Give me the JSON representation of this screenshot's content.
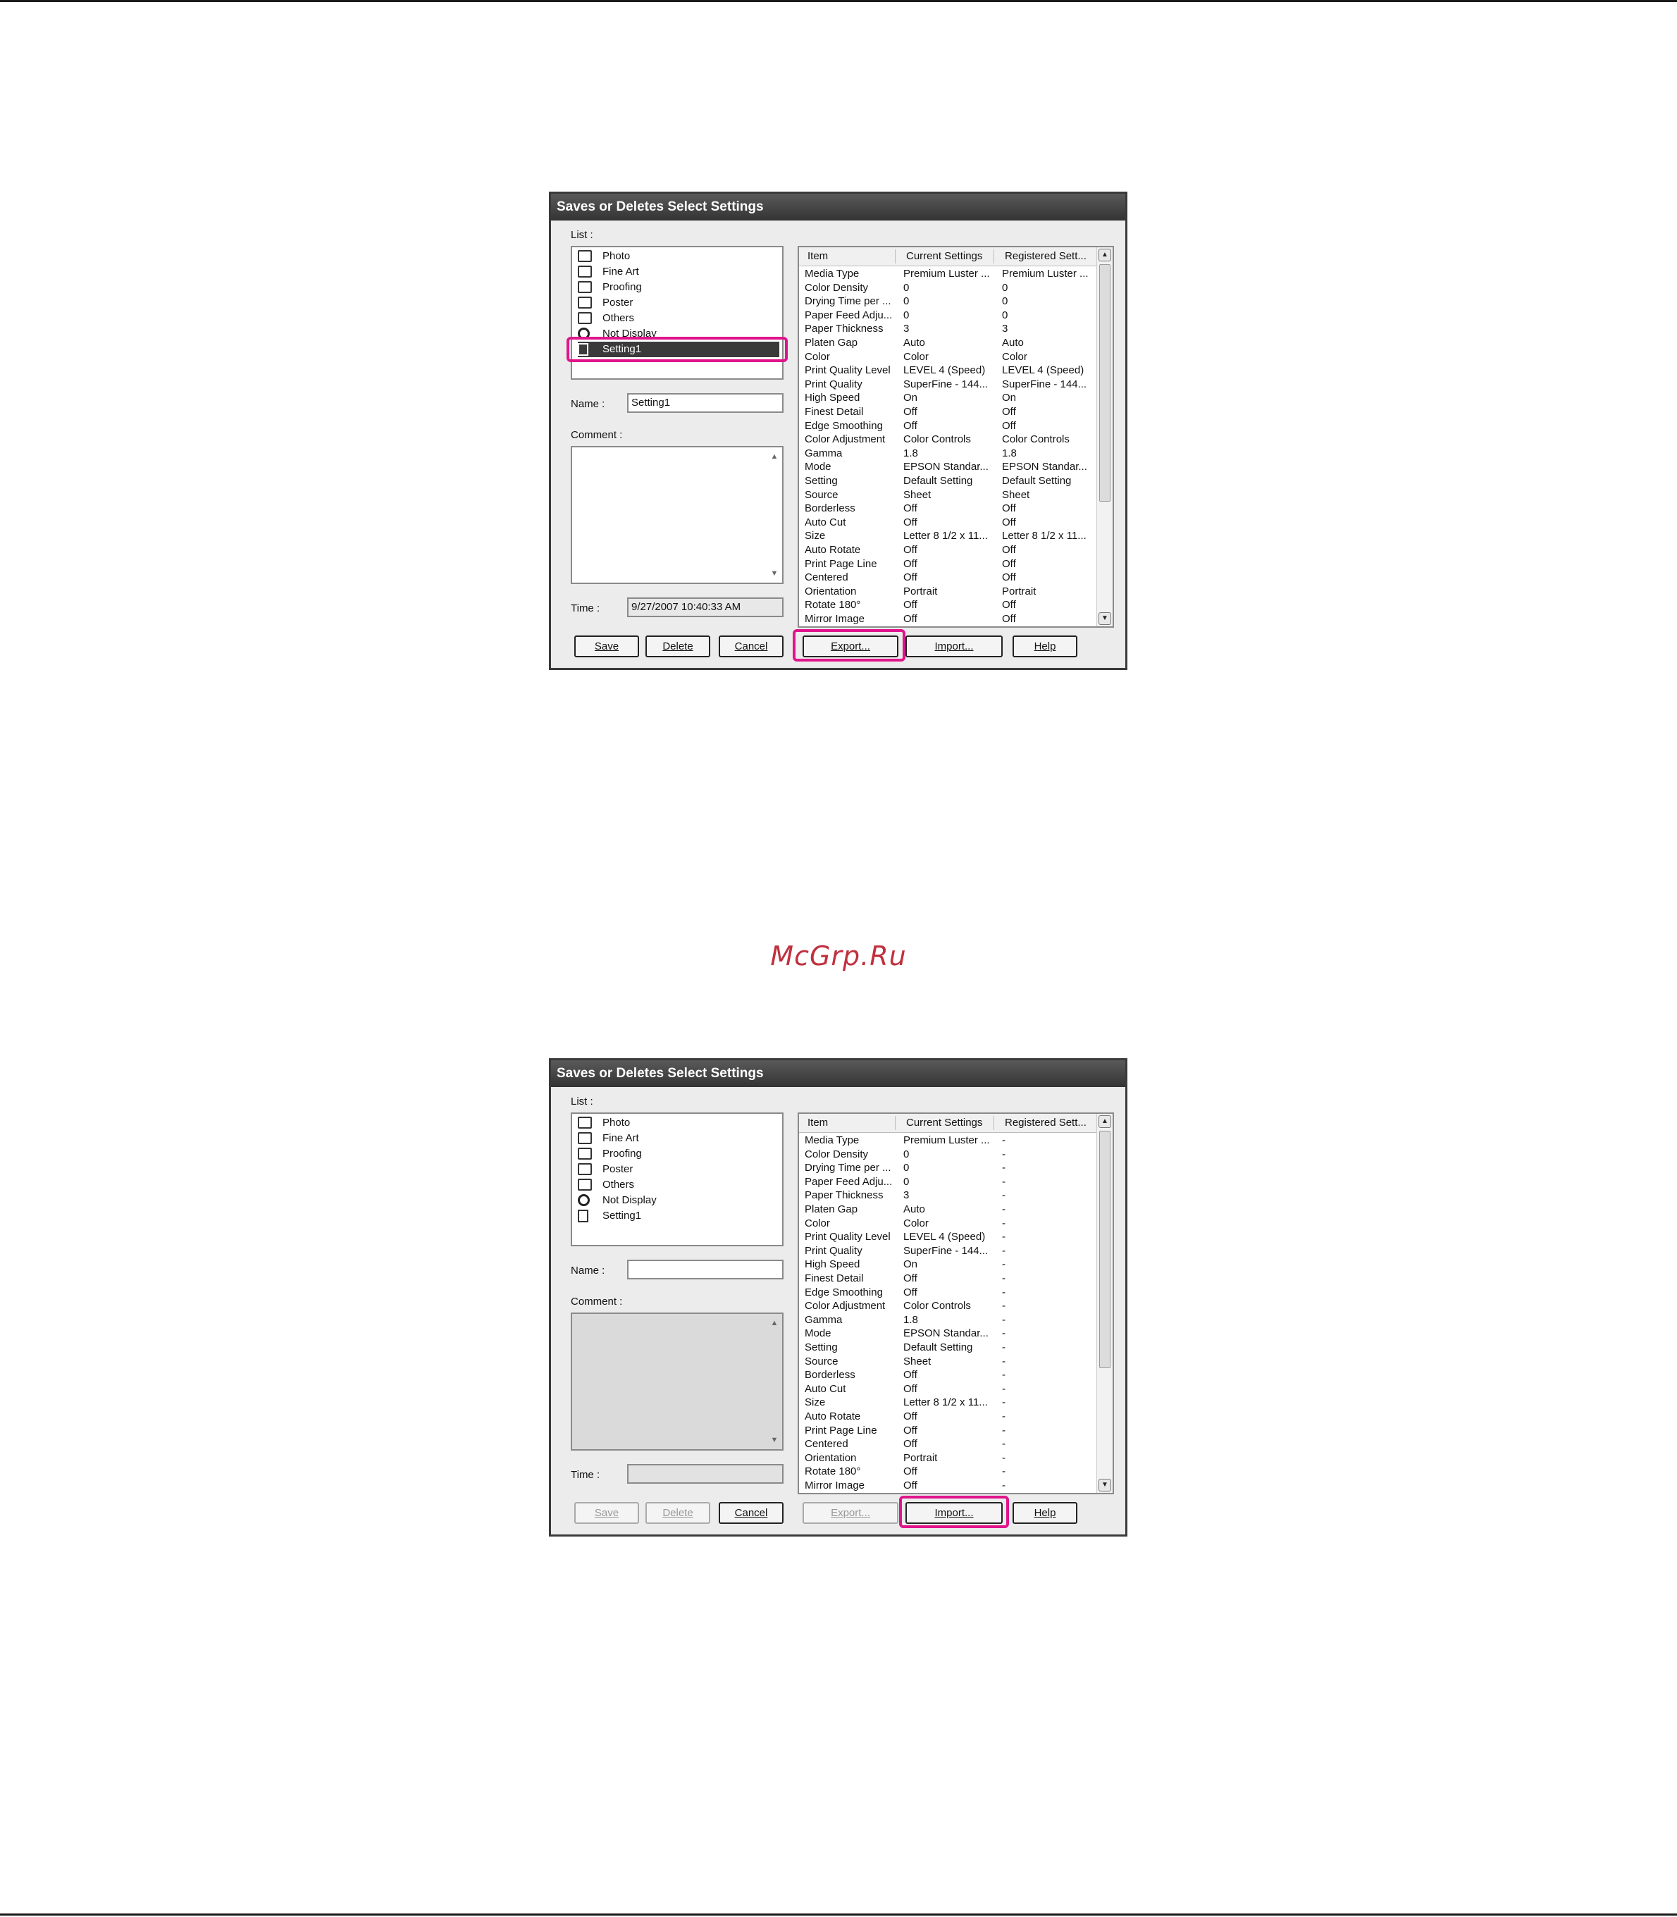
{
  "watermark": "McGrp.Ru",
  "dialogs": [
    {
      "title": "Saves or Deletes Select Settings",
      "list_label": "List :",
      "list_items": [
        {
          "label": "Photo",
          "icon": "folder-icon"
        },
        {
          "label": "Fine Art",
          "icon": "folder-icon"
        },
        {
          "label": "Proofing",
          "icon": "folder-icon"
        },
        {
          "label": "Poster",
          "icon": "folder-icon"
        },
        {
          "label": "Others",
          "icon": "folder-icon"
        },
        {
          "label": "Not Display",
          "icon": "not-display-icon"
        },
        {
          "label": "Setting1",
          "icon": "document-icon",
          "selected": true
        }
      ],
      "name_label": "Name :",
      "name_value": "Setting1",
      "comment_label": "Comment :",
      "time_label": "Time :",
      "time_value": "9/27/2007 10:40:33 AM",
      "grid_headers": [
        "Item",
        "Current Settings",
        "Registered Sett..."
      ],
      "rows": [
        [
          "Media Type",
          "Premium Luster ...",
          "Premium Luster ..."
        ],
        [
          "Color Density",
          "0",
          "0"
        ],
        [
          "Drying Time per ...",
          "0",
          "0"
        ],
        [
          "Paper Feed Adju...",
          "0",
          "0"
        ],
        [
          "Paper Thickness",
          "3",
          "3"
        ],
        [
          "Platen Gap",
          "Auto",
          "Auto"
        ],
        [
          "Color",
          "Color",
          "Color"
        ],
        [
          "Print Quality Level",
          "LEVEL 4 (Speed)",
          "LEVEL 4 (Speed)"
        ],
        [
          "Print Quality",
          "SuperFine - 144...",
          "SuperFine - 144..."
        ],
        [
          "High Speed",
          "On",
          "On"
        ],
        [
          "Finest Detail",
          "Off",
          "Off"
        ],
        [
          "Edge Smoothing",
          "Off",
          "Off"
        ],
        [
          "Color Adjustment",
          "Color Controls",
          "Color Controls"
        ],
        [
          "Gamma",
          "1.8",
          "1.8"
        ],
        [
          "Mode",
          "EPSON Standar...",
          "EPSON Standar..."
        ],
        [
          "Setting",
          "Default Setting",
          "Default Setting"
        ],
        [
          "Source",
          "Sheet",
          "Sheet"
        ],
        [
          "Borderless",
          "Off",
          "Off"
        ],
        [
          "Auto Cut",
          "Off",
          "Off"
        ],
        [
          "Size",
          "Letter 8 1/2 x 11...",
          "Letter 8 1/2 x 11..."
        ],
        [
          "Auto Rotate",
          "Off",
          "Off"
        ],
        [
          "Print Page Line",
          "Off",
          "Off"
        ],
        [
          "Centered",
          "Off",
          "Off"
        ],
        [
          "Orientation",
          "Portrait",
          "Portrait"
        ],
        [
          "Rotate 180°",
          "Off",
          "Off"
        ],
        [
          "Mirror Image",
          "Off",
          "Off"
        ]
      ],
      "buttons": {
        "save": "Save",
        "delete": "Delete",
        "cancel": "Cancel",
        "export": "Export...",
        "import": "Import...",
        "help": "Help"
      }
    },
    {
      "title": "Saves or Deletes Select Settings",
      "list_label": "List :",
      "list_items": [
        {
          "label": "Photo",
          "icon": "folder-icon"
        },
        {
          "label": "Fine Art",
          "icon": "folder-icon"
        },
        {
          "label": "Proofing",
          "icon": "folder-icon"
        },
        {
          "label": "Poster",
          "icon": "folder-icon"
        },
        {
          "label": "Others",
          "icon": "folder-icon"
        },
        {
          "label": "Not Display",
          "icon": "not-display-icon"
        },
        {
          "label": "Setting1",
          "icon": "document-icon",
          "selected": false
        }
      ],
      "name_label": "Name :",
      "name_value": "",
      "comment_label": "Comment :",
      "time_label": "Time :",
      "time_value": "",
      "grid_headers": [
        "Item",
        "Current Settings",
        "Registered Sett..."
      ],
      "rows": [
        [
          "Media Type",
          "Premium Luster ...",
          "-"
        ],
        [
          "Color Density",
          "0",
          "-"
        ],
        [
          "Drying Time per ...",
          "0",
          "-"
        ],
        [
          "Paper Feed Adju...",
          "0",
          "-"
        ],
        [
          "Paper Thickness",
          "3",
          "-"
        ],
        [
          "Platen Gap",
          "Auto",
          "-"
        ],
        [
          "Color",
          "Color",
          "-"
        ],
        [
          "Print Quality Level",
          "LEVEL 4 (Speed)",
          "-"
        ],
        [
          "Print Quality",
          "SuperFine - 144...",
          "-"
        ],
        [
          "High Speed",
          "On",
          "-"
        ],
        [
          "Finest Detail",
          "Off",
          "-"
        ],
        [
          "Edge Smoothing",
          "Off",
          "-"
        ],
        [
          "Color Adjustment",
          "Color Controls",
          "-"
        ],
        [
          "Gamma",
          "1.8",
          "-"
        ],
        [
          "Mode",
          "EPSON Standar...",
          "-"
        ],
        [
          "Setting",
          "Default Setting",
          "-"
        ],
        [
          "Source",
          "Sheet",
          "-"
        ],
        [
          "Borderless",
          "Off",
          "-"
        ],
        [
          "Auto Cut",
          "Off",
          "-"
        ],
        [
          "Size",
          "Letter 8 1/2 x 11...",
          "-"
        ],
        [
          "Auto Rotate",
          "Off",
          "-"
        ],
        [
          "Print Page Line",
          "Off",
          "-"
        ],
        [
          "Centered",
          "Off",
          "-"
        ],
        [
          "Orientation",
          "Portrait",
          "-"
        ],
        [
          "Rotate 180°",
          "Off",
          "-"
        ],
        [
          "Mirror Image",
          "Off",
          "-"
        ]
      ],
      "buttons": {
        "save": "Save",
        "delete": "Delete",
        "cancel": "Cancel",
        "export": "Export...",
        "import": "Import...",
        "help": "Help"
      }
    }
  ]
}
